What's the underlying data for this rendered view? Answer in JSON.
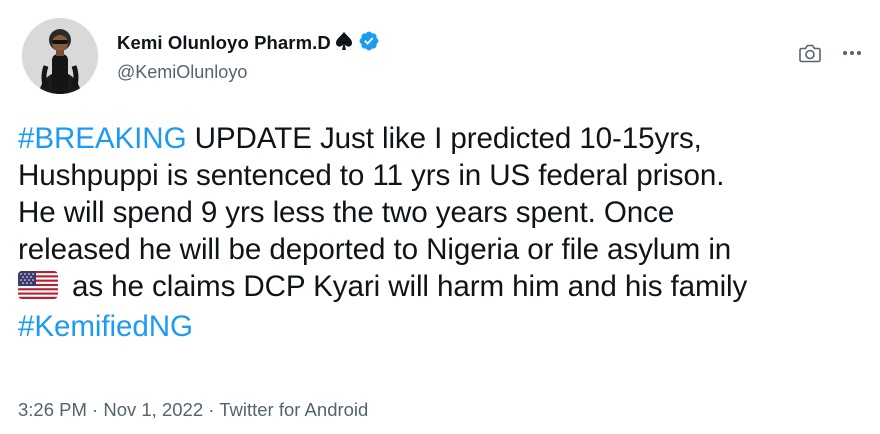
{
  "author": {
    "display_name": "Kemi Olunloyo Pharm.D",
    "handle": "@KemiOlunloyo"
  },
  "tweet": {
    "line1_tag": "#BREAKING",
    "line1_rest": " UPDATE Just like I predicted 10-15yrs,",
    "line2": "Hushpuppi is sentenced to 11 yrs in US federal prison.",
    "line3": "He will spend 9 yrs less the two years spent. Once",
    "line4": "released he will be deported to Nigeria or file asylum in",
    "line5": "as he claims DCP Kyari will harm him and his family",
    "line6_tag": "#KemifiedNG"
  },
  "meta": {
    "time": "3:26 PM",
    "sep1": " · ",
    "date": "Nov 1, 2022",
    "sep2": " · ",
    "source": "Twitter for Android"
  },
  "icons": {
    "camera": "camera-icon",
    "more": "more-icon",
    "verified": "verified-badge-icon",
    "spade": "spade-icon",
    "flag": "us-flag-emoji"
  },
  "colors": {
    "link": "#1d9bf0",
    "secondary_text": "#536471",
    "primary_text": "#0f1419"
  }
}
